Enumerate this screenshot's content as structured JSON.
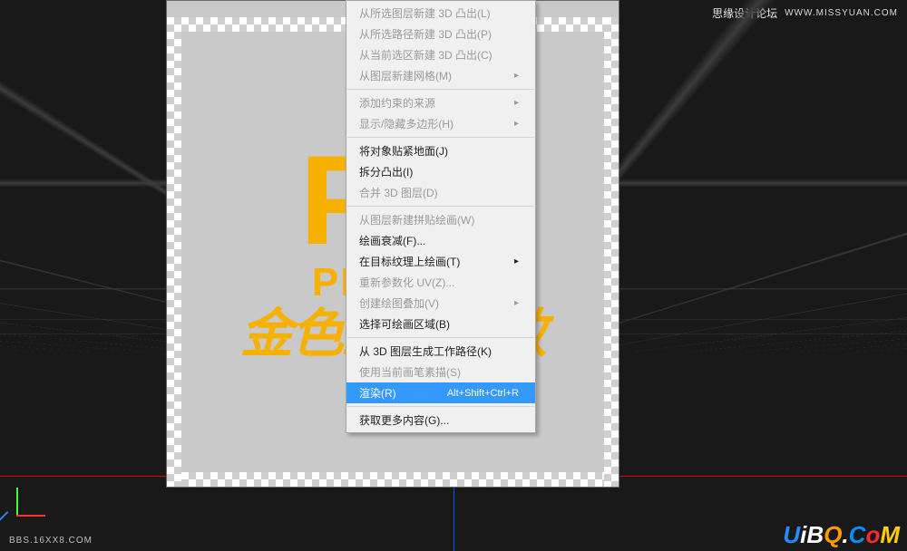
{
  "watermark": {
    "top_text": "思缘设计论坛",
    "top_url": "WWW.MISSYUAN.COM",
    "bottom_left": "BBS.16XX8.COM",
    "logo": {
      "u": "U",
      "i": "i",
      "b": "B",
      "q": "Q",
      "dot": ".",
      "c": "C",
      "o": "o",
      "m": "M"
    }
  },
  "canvas_art": {
    "row1": "P   S",
    "row2": "PH        OPE",
    "row3": "金色立体字效"
  },
  "menu": {
    "items": [
      {
        "label": "从所选图层新建 3D 凸出(L)",
        "enabled": false
      },
      {
        "label": "从所选路径新建 3D 凸出(P)",
        "enabled": false
      },
      {
        "label": "从当前选区新建 3D 凸出(C)",
        "enabled": false
      },
      {
        "label": "从图层新建网格(M)",
        "enabled": false,
        "sub": true
      },
      {
        "sep": true
      },
      {
        "label": "添加约束的来源",
        "enabled": false,
        "sub": true
      },
      {
        "label": "显示/隐藏多边形(H)",
        "enabled": false,
        "sub": true
      },
      {
        "sep": true
      },
      {
        "label": "将对象贴紧地面(J)",
        "enabled": true
      },
      {
        "label": "拆分凸出(I)",
        "enabled": true
      },
      {
        "label": "合并 3D 图层(D)",
        "enabled": false
      },
      {
        "sep": true
      },
      {
        "label": "从图层新建拼贴绘画(W)",
        "enabled": false
      },
      {
        "label": "绘画衰减(F)...",
        "enabled": true
      },
      {
        "label": "在目标纹理上绘画(T)",
        "enabled": true,
        "sub": true
      },
      {
        "label": "重新参数化 UV(Z)...",
        "enabled": false
      },
      {
        "label": "创建绘图叠加(V)",
        "enabled": false,
        "sub": true
      },
      {
        "label": "选择可绘画区域(B)",
        "enabled": true
      },
      {
        "sep": true
      },
      {
        "label": "从 3D 图层生成工作路径(K)",
        "enabled": true
      },
      {
        "label": "使用当前画笔素描(S)",
        "enabled": false
      },
      {
        "label": "渲染(R)",
        "enabled": true,
        "shortcut": "Alt+Shift+Ctrl+R",
        "highlight": true
      },
      {
        "sep": true
      },
      {
        "label": "获取更多内容(G)...",
        "enabled": true
      }
    ]
  }
}
